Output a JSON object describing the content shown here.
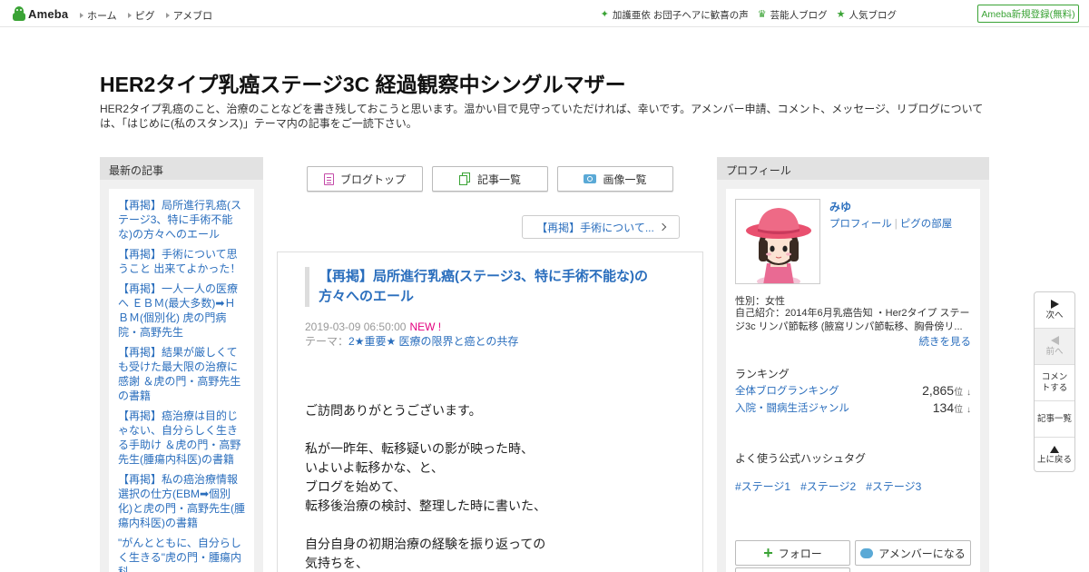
{
  "topbar": {
    "logo": "Ameba",
    "nav": [
      "ホーム",
      "ピグ",
      "アメブロ"
    ],
    "right_links": [
      {
        "icon": "sparkle-icon",
        "label": "加護亜依 お団子ヘアに歓喜の声"
      },
      {
        "icon": "crown-icon",
        "label": "芸能人ブログ"
      },
      {
        "icon": "star-icon",
        "label": "人気ブログ"
      }
    ],
    "signup": "Ameba新規登録(無料)",
    "accent": "#3aa335"
  },
  "header": {
    "title": "HER2タイプ乳癌ステージ3C 経過観察中シングルマザー",
    "description": "HER2タイプ乳癌のこと、治療のことなどを書き残しておこうと思います。温かい目で見守っていただければ、幸いです。アメンバー申請、コメント、メッセージ、リブログについては、「はじめに(私のスタンス)」テーマ内の記事をご一読下さい。"
  },
  "left_sidebar": {
    "heading": "最新の記事",
    "items": [
      "【再掲】局所進行乳癌(ステージ3、特に手術不能な)の方々へのエール",
      "【再掲】手術について思うこと 出来てよかった！",
      "【再掲】一人一人の医療へ ＥＢＭ(最大多数)➡ＨＢＭ(個別化) 虎の門病院・高野先生",
      "【再掲】結果が厳しくても受けた最大限の治療に感謝 ＆虎の門・高野先生の書籍",
      "【再掲】癌治療は目的じゃない、自分らしく生きる手助け ＆虎の門・高野先生(腫瘍内科医)の書籍",
      "【再掲】私の癌治療情報選択の仕方(EBM➡個別化)と虎の門・高野先生(腫瘍内科医)の書籍",
      "\"がんとともに、自分らしく生きる\"虎の門・腫瘍内科"
    ]
  },
  "center": {
    "buttons": {
      "blog_top": "ブログトップ",
      "article_list": "記事一覧",
      "image_list": "画像一覧"
    },
    "prev_article": "【再掲】手術について...",
    "entry": {
      "title": "【再掲】局所進行乳癌(ステージ3、特に手術不能な)の方々へのエール",
      "date": "2019-03-09 06:50:00",
      "new_badge": "NEW !",
      "theme_label": "テーマ：",
      "theme": "2★重要★ 医療の限界と癌との共存",
      "body": [
        "ご訪問ありがとうございます。",
        "",
        "私が一昨年、転移疑いの影が映った時、",
        "いよいよ転移かな、と、",
        "ブログを始めて、",
        "転移後治療の検討、整理した時に書いた、",
        "",
        "自分自身の初期治療の経験を振り返っての",
        "気持ちを、"
      ]
    }
  },
  "right_sidebar": {
    "heading": "プロフィール",
    "name": "みゆ",
    "links": [
      "プロフィール",
      "ピグの部屋"
    ],
    "gender": "性別：女性",
    "intro": "自己紹介：2014年6月乳癌告知 ・Her2タイプ ステージ3c リンパ節転移 (腋窩リンパ節転移、胸骨傍リ...",
    "more": "続きを見る",
    "ranking_heading": "ランキング",
    "rankings": [
      {
        "label": "全体ブログランキング",
        "value": "2,865",
        "unit": "位",
        "trend": "↓"
      },
      {
        "label": "入院・闘病生活ジャンル",
        "value": "134",
        "unit": "位",
        "trend": "↓"
      }
    ],
    "hashtag_heading": "よく使う公式ハッシュタグ",
    "hashtags": [
      "#ステージ1",
      "#ステージ2",
      "#ステージ3"
    ],
    "follow": "フォロー",
    "amember": "アメンバーになる"
  },
  "float_nav": {
    "next": "次へ",
    "prev": "前へ",
    "comment": "コメントする",
    "list": "記事一覧",
    "top": "上に戻る"
  }
}
